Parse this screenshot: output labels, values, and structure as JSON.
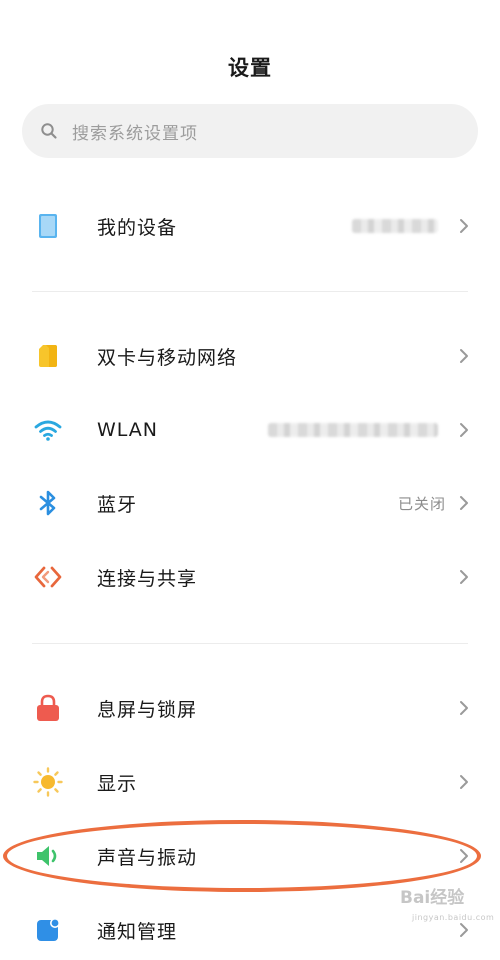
{
  "header": {
    "title": "设置"
  },
  "search": {
    "placeholder": "搜索系统设置项",
    "icon": "search-icon"
  },
  "items": [
    {
      "id": "my-device",
      "label": "我的设备",
      "icon": "phone-icon",
      "icon_color": "#3aa3e8",
      "value": ""
    },
    {
      "id": "dual-sim",
      "label": "双卡与移动网络",
      "icon": "sim-card-icon",
      "icon_color": "#f5c518",
      "value": ""
    },
    {
      "id": "wlan",
      "label": "WLAN",
      "icon": "wifi-icon",
      "icon_color": "#2aa8e0",
      "value": ""
    },
    {
      "id": "bluetooth",
      "label": "蓝牙",
      "icon": "bluetooth-icon",
      "icon_color": "#2b8fe0",
      "value": "已关闭"
    },
    {
      "id": "connection-sharing",
      "label": "连接与共享",
      "icon": "share-icon",
      "icon_color": "#e8673c",
      "value": ""
    },
    {
      "id": "lock-screen",
      "label": "息屏与锁屏",
      "icon": "lock-icon",
      "icon_color": "#ee5b4f",
      "value": ""
    },
    {
      "id": "display",
      "label": "显示",
      "icon": "sun-icon",
      "icon_color": "#f7b92e",
      "value": ""
    },
    {
      "id": "sound-vibration",
      "label": "声音与振动",
      "icon": "speaker-icon",
      "icon_color": "#3ec36b",
      "value": ""
    },
    {
      "id": "notifications",
      "label": "通知管理",
      "icon": "notification-icon",
      "icon_color": "#2f8fe6",
      "value": ""
    }
  ],
  "annotation": {
    "color": "#ec6e3f",
    "highlighted_item": "sound-vibration"
  },
  "watermark": {
    "text": "Bai经验",
    "sub": "jingyan.baidu.com"
  }
}
